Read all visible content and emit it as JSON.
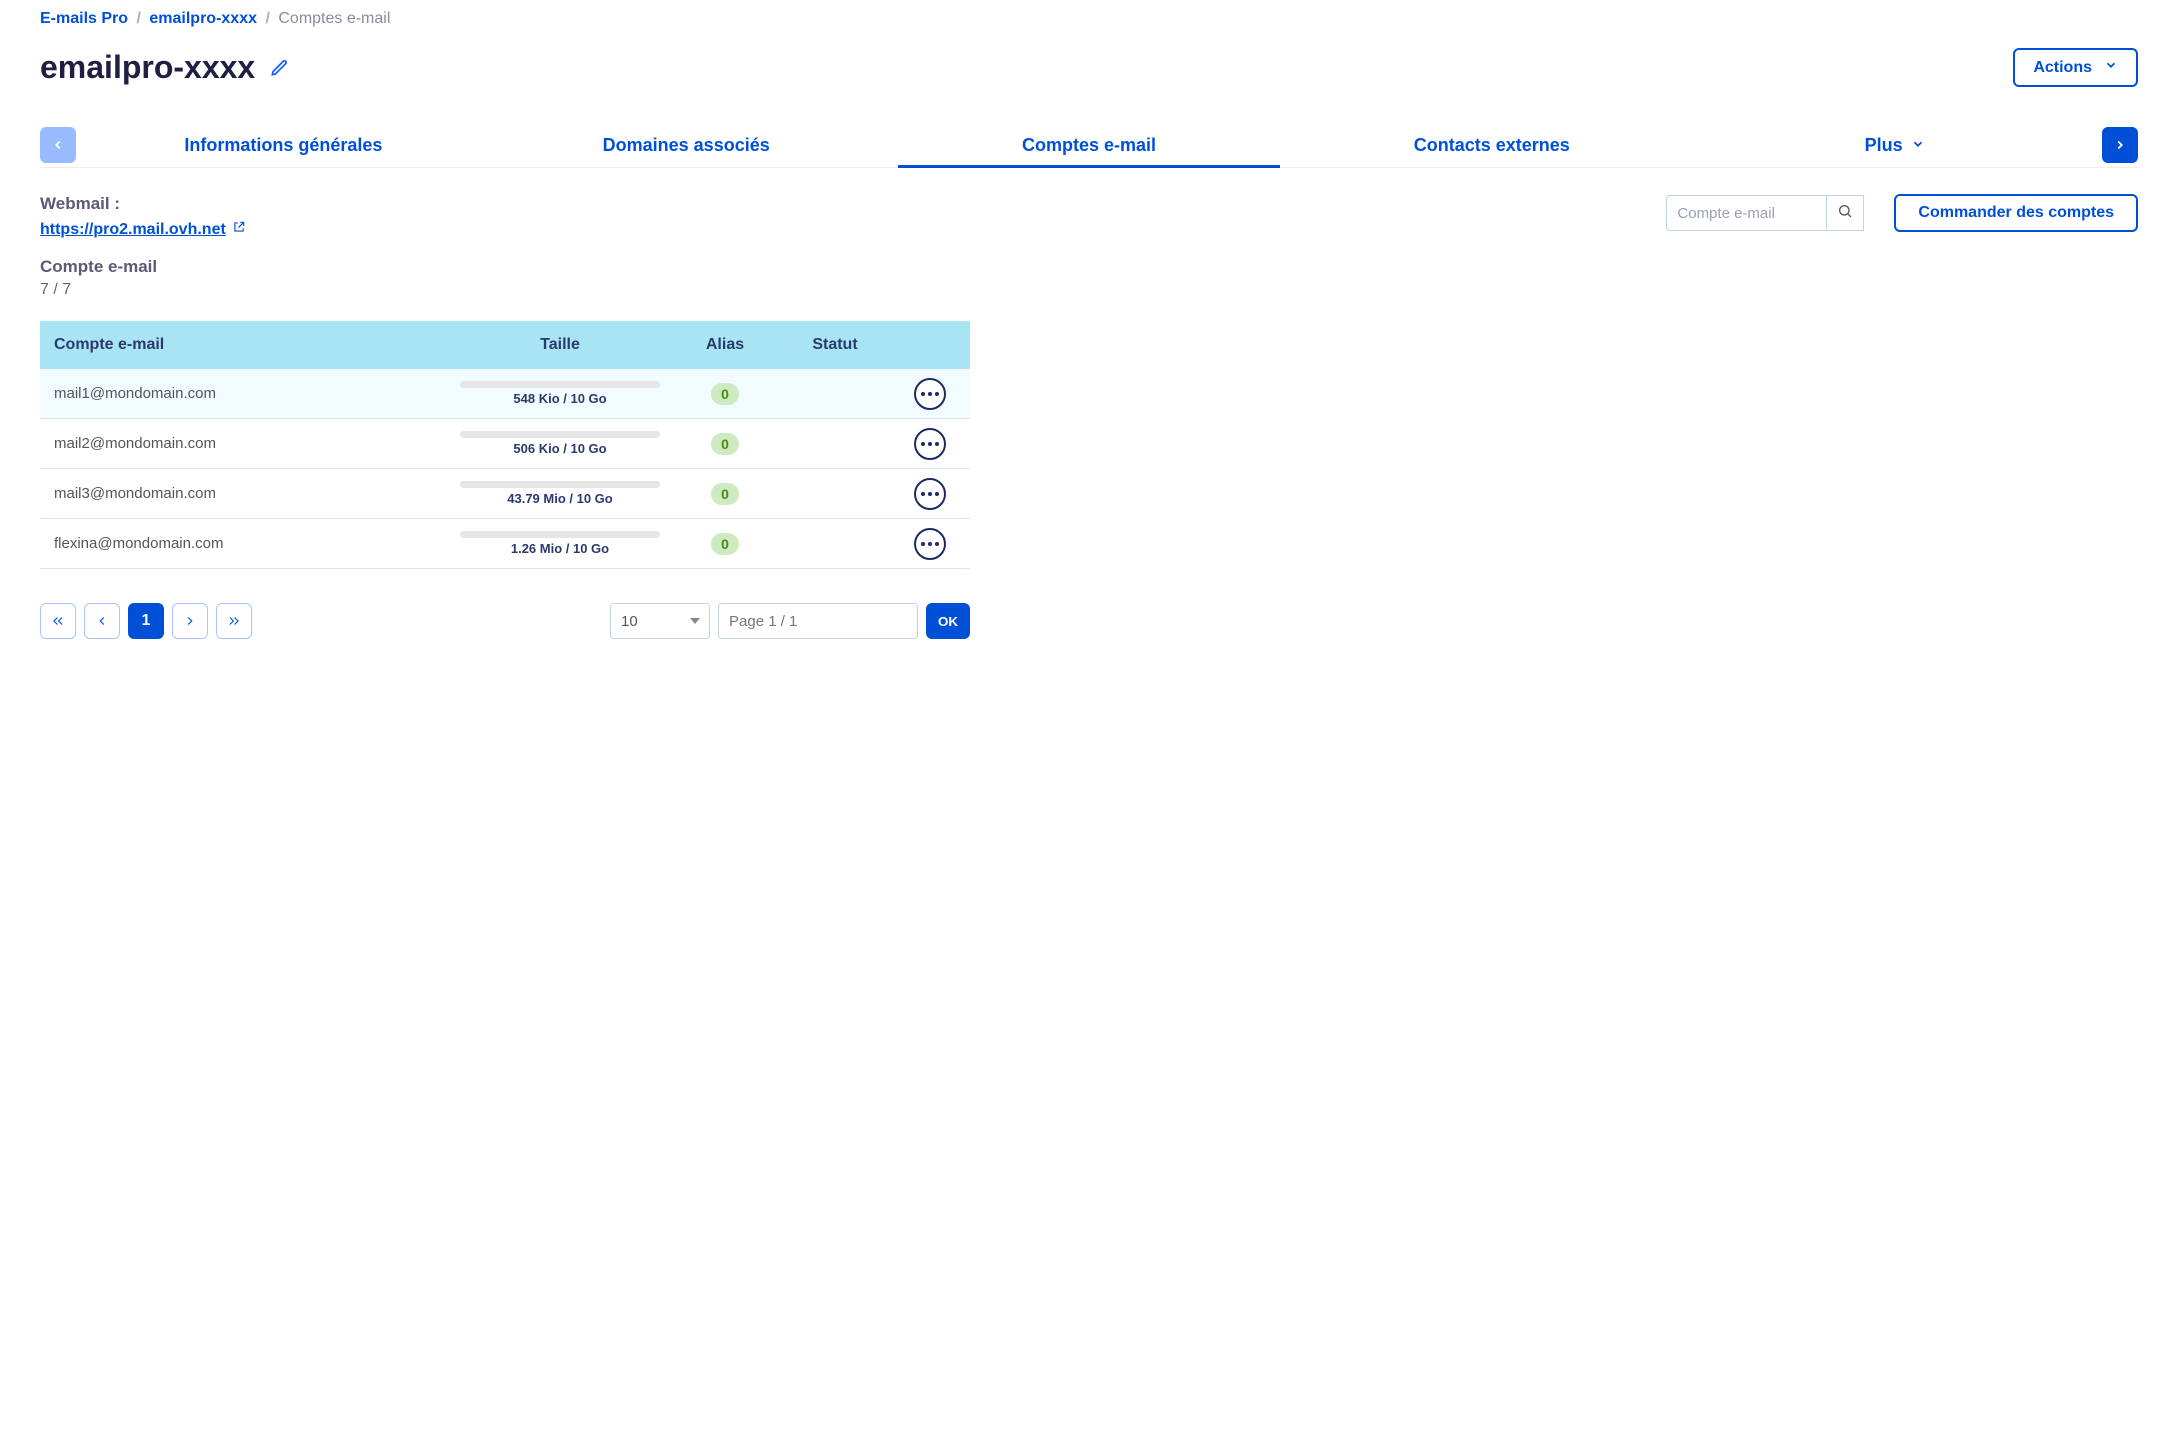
{
  "breadcrumb": {
    "root": "E-mails Pro",
    "service": "emailpro-xxxx",
    "current": "Comptes e-mail"
  },
  "title": "emailpro-xxxx",
  "actions_label": "Actions",
  "tabs": {
    "general": "Informations générales",
    "domains": "Domaines associés",
    "accounts": "Comptes e-mail",
    "contacts": "Contacts externes",
    "more": "Plus"
  },
  "webmail": {
    "label": "Webmail :",
    "url": "https://pro2.mail.ovh.net"
  },
  "accounts_box": {
    "label": "Compte e-mail",
    "count": "7 / 7"
  },
  "search": {
    "placeholder": "Compte e-mail"
  },
  "order_button": "Commander des comptes",
  "table": {
    "headers": {
      "email": "Compte e-mail",
      "size": "Taille",
      "alias": "Alias",
      "status": "Statut"
    },
    "rows": [
      {
        "email": "mail1@mondomain.com",
        "size": "548 Kio / 10 Go",
        "alias": "0"
      },
      {
        "email": "mail2@mondomain.com",
        "size": "506 Kio / 10 Go",
        "alias": "0"
      },
      {
        "email": "mail3@mondomain.com",
        "size": "43.79 Mio / 10 Go",
        "alias": "0"
      },
      {
        "email": "flexina@mondomain.com",
        "size": "1.26 Mio / 10 Go",
        "alias": "0"
      }
    ]
  },
  "pagination": {
    "current": "1",
    "page_size": "10",
    "page_of": "Page 1 / 1",
    "ok": "OK"
  }
}
